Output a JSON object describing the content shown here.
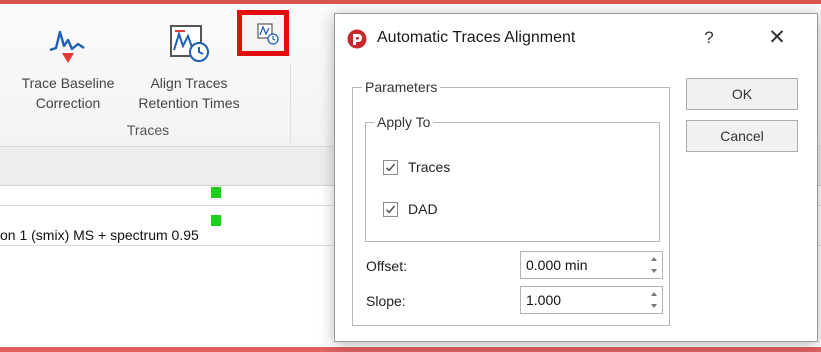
{
  "ribbon": {
    "trace_baseline_line1": "Trace Baseline",
    "trace_baseline_line2": "Correction",
    "align_traces_line1": "Align Traces",
    "align_traces_line2": "Retention Times",
    "group_label": "Traces"
  },
  "chromatogram": {
    "trace_label": "on 1 (smix) MS + spectrum 0.95"
  },
  "dialog": {
    "title": "Automatic Traces Alignment",
    "help_label": "?",
    "close_label": "✕",
    "parameters_legend": "Parameters",
    "apply_to_legend": "Apply To",
    "traces_label": "Traces",
    "traces_checked": true,
    "dad_label": "DAD",
    "dad_checked": true,
    "offset_label": "Offset:",
    "offset_value": "0.000 min",
    "slope_label": "Slope:",
    "slope_value": "1.000",
    "ok_label": "OK",
    "cancel_label": "Cancel"
  },
  "colors": {
    "highlight_border": "#e40d0d",
    "marker_green": "#1ccf1c",
    "app_accent": "#d9534f"
  }
}
